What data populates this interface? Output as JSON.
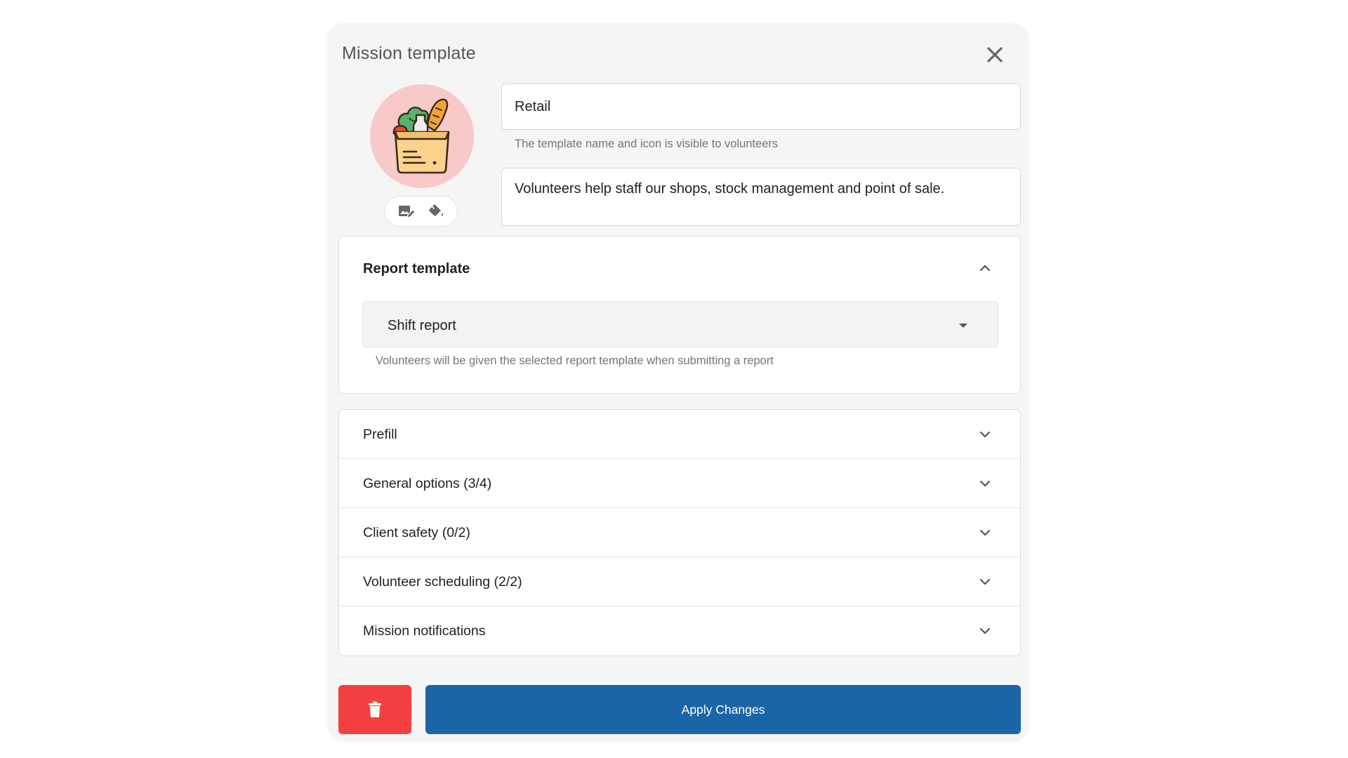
{
  "modal": {
    "title": "Mission template",
    "close_icon": "close-icon"
  },
  "template_icon": {
    "name": "grocery-bag-icon",
    "background_color": "#f8c9c9",
    "actions": [
      {
        "icon": "edit-image-icon"
      },
      {
        "icon": "paint-bucket-icon"
      }
    ]
  },
  "name_field": {
    "value": "Retail",
    "helper": "The template name and icon is visible to volunteers"
  },
  "description_field": {
    "value": "Volunteers help staff our shops, stock management and point of sale."
  },
  "report_template": {
    "title": "Report template",
    "expanded": true,
    "selected": "Shift report",
    "helper": "Volunteers will be given the selected report template when submitting a report"
  },
  "sections": [
    {
      "label": "Prefill"
    },
    {
      "label": "General options (3/4)"
    },
    {
      "label": "Client safety (0/2)"
    },
    {
      "label": "Volunteer scheduling (2/2)"
    },
    {
      "label": "Mission notifications"
    }
  ],
  "footer": {
    "delete_icon": "trash-icon",
    "delete_color": "#f44040",
    "apply_label": "Apply Changes",
    "apply_color": "#1b64a8"
  }
}
